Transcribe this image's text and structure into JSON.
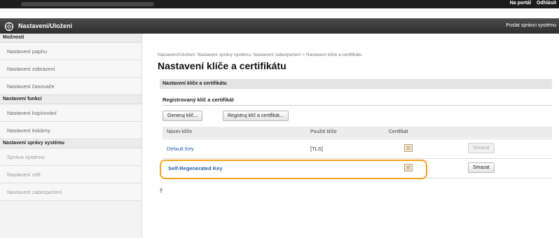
{
  "topbar": {
    "portal_label": "Na portál",
    "logout_label": "Odhlásit"
  },
  "header": {
    "title": "Nastavení/Uložení",
    "send_email_label": "Poslat správci systému"
  },
  "sidebar": {
    "groups": [
      {
        "label": "Možnosti"
      },
      {
        "label": "Nastavení funkcí"
      },
      {
        "label": "Nastavení správy systému"
      }
    ],
    "items": [
      {
        "label": "Nastavení papíru"
      },
      {
        "label": "Nastavení zobrazení"
      },
      {
        "label": "Nastavení časovače"
      },
      {
        "label": "Nastavení kopírování"
      },
      {
        "label": "Nastavení tiskárny"
      },
      {
        "label": "Správa systému"
      },
      {
        "label": "Nastavení sítě"
      },
      {
        "label": "Nastavení zabezpečení"
      }
    ]
  },
  "main": {
    "breadcrumb": "Nastavení/Uložení: Nastavení správy systému: Nastavení zabezpečení > Nastavení klíče a certifikátu",
    "title": "Nastavení klíče a certifikátu",
    "section_label": "Nastavení klíče a certifikátu",
    "subhead": "Registrovaný klíč a certifikát",
    "generate_button": "Generuj klíč...",
    "register_button": "Registruj klíč a certifikát...",
    "table": {
      "headers": [
        "Název klíče",
        "Použití klíče",
        "Certifikát"
      ],
      "rows": [
        {
          "name": "Default Key",
          "usage": "[TLS]",
          "delete_label": "Smazat",
          "delete_enabled": false
        },
        {
          "name": "Self-Regenerated Key",
          "usage": "",
          "delete_label": "Smazat",
          "delete_enabled": true
        }
      ]
    },
    "highlight_color": "#f5a21b",
    "link_color": "#2a5fa8"
  }
}
